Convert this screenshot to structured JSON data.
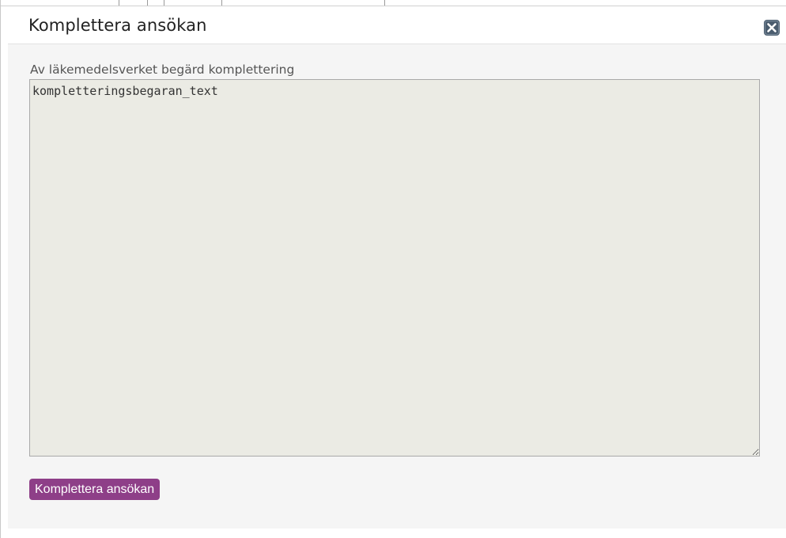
{
  "dialog": {
    "title": "Komplettera ansökan",
    "close_icon": "close-x-icon"
  },
  "form": {
    "label": "Av läkemedelsverket begärd komplettering",
    "textarea_value": "kompletteringsbegaran_text",
    "submit_label": "Komplettera ansökan"
  },
  "colors": {
    "button_bg": "#8e3f88",
    "textarea_bg": "#ebebe4",
    "dialog_bg": "#f5f5f5",
    "close_icon": "#4a5c6e"
  }
}
